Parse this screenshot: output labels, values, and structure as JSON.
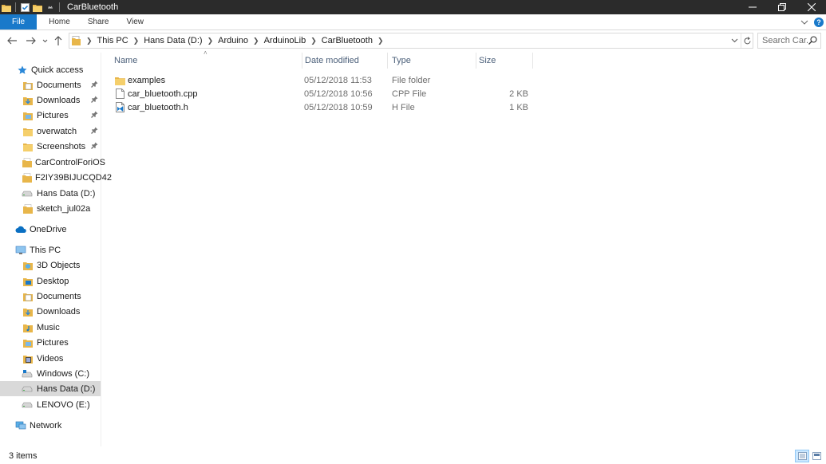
{
  "window": {
    "title": "CarBluetooth"
  },
  "ribbon": {
    "tabs": [
      "File",
      "Home",
      "Share",
      "View"
    ]
  },
  "address": {
    "crumbs": [
      "This PC",
      "Hans Data (D:)",
      "Arduino",
      "ArduinoLib",
      "CarBluetooth"
    ]
  },
  "search": {
    "placeholder": "Search Car..."
  },
  "sidebar": {
    "quick_access": "Quick access",
    "quick_items": [
      "Documents",
      "Downloads",
      "Pictures",
      "overwatch",
      "Screenshots",
      "CarControlForiOS",
      "F2IY39BIJUCQD42",
      "Hans Data (D:)",
      "sketch_jul02a"
    ],
    "onedrive": "OneDrive",
    "this_pc": "This PC",
    "pc_items": [
      "3D Objects",
      "Desktop",
      "Documents",
      "Downloads",
      "Music",
      "Pictures",
      "Videos",
      "Windows (C:)",
      "Hans Data (D:)",
      "LENOVO (E:)"
    ],
    "network": "Network"
  },
  "columns": {
    "name": "Name",
    "date": "Date modified",
    "type": "Type",
    "size": "Size"
  },
  "files": [
    {
      "name": "examples",
      "date": "05/12/2018 11:53",
      "type": "File folder",
      "size": "",
      "icon": "folder-icon"
    },
    {
      "name": "car_bluetooth.cpp",
      "date": "05/12/2018 10:56",
      "type": "CPP File",
      "size": "2 KB",
      "icon": "file-icon"
    },
    {
      "name": "car_bluetooth.h",
      "date": "05/12/2018 10:59",
      "type": "H File",
      "size": "1 KB",
      "icon": "code-file-icon"
    }
  ],
  "status": {
    "items_count": "3 items"
  },
  "colors": {
    "accent": "#1979ca",
    "folder": "#e8b64a",
    "selected": "#d9d9d9"
  }
}
